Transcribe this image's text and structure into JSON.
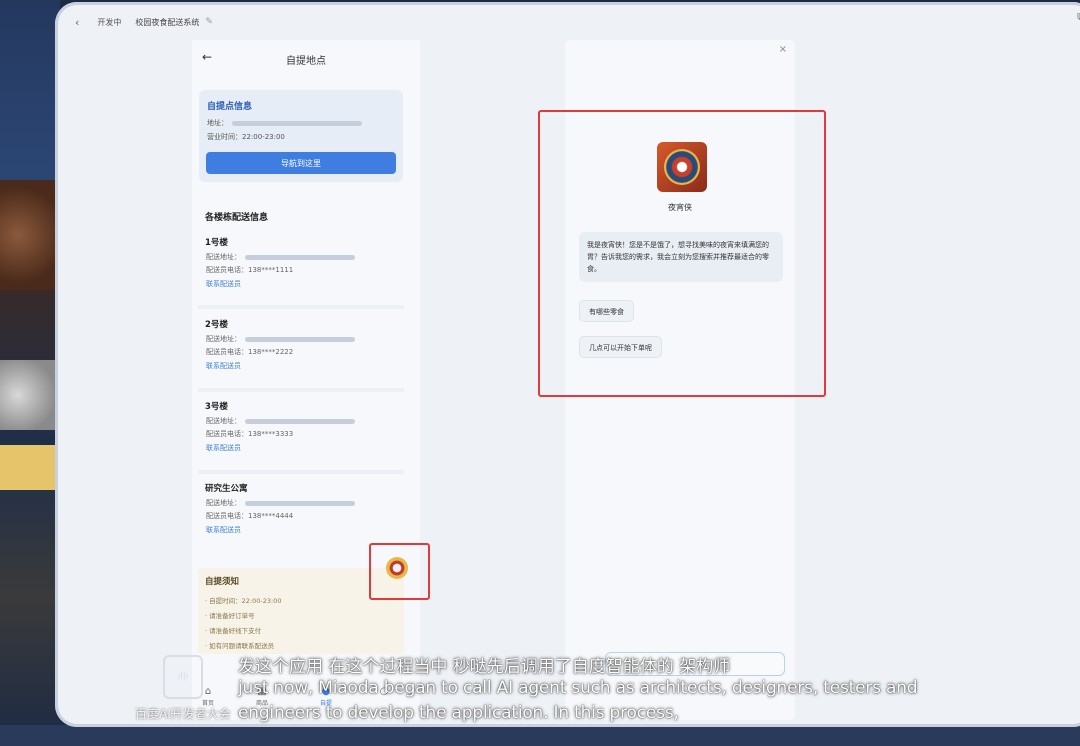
{
  "topbar": {
    "back_icon": "chevron-left-icon",
    "status": "开发中",
    "app_title": "校园夜食配送系统",
    "edit_icon": "edit-icon",
    "expand_icon": "expand-icon"
  },
  "phone": {
    "header_title": "自提地点",
    "pickup": {
      "title": "自提点信息",
      "address_label": "地址：",
      "hours_label": "营业时间：",
      "hours_value": "22:00-23:00",
      "nav_button": "导航到这里"
    },
    "buildings_title": "各楼栋配送信息",
    "buildings": [
      {
        "name": "1号楼",
        "address_label": "配送地址：",
        "phone_label": "配送员电话：",
        "phone": "138****1111",
        "link": "联系配送员"
      },
      {
        "name": "2号楼",
        "address_label": "配送地址：",
        "phone_label": "配送员电话：",
        "phone": "138****2222",
        "link": "联系配送员"
      },
      {
        "name": "3号楼",
        "address_label": "配送地址：",
        "phone_label": "配送员电话：",
        "phone": "138****3333",
        "link": "联系配送员"
      },
      {
        "name": "研究生公寓",
        "address_label": "配送地址：",
        "phone_label": "配送员电话：",
        "phone": "138****4444",
        "link": "联系配送员"
      }
    ],
    "notice": {
      "title": "自提须知",
      "items": [
        "自提时间：22:00-23:00",
        "请准备好订单号",
        "请准备好线下支付",
        "如有问题请联系配送员"
      ]
    },
    "bottom_nav": [
      {
        "label": "首页",
        "icon": "home-icon"
      },
      {
        "label": "商品",
        "icon": "goods-icon"
      },
      {
        "label": "自提",
        "icon": "location-icon"
      },
      {
        "label": "",
        "icon": "user-icon"
      }
    ]
  },
  "chat": {
    "close_icon": "close-icon",
    "agent_name": "夜宵侠",
    "greeting": "我是夜宵侠！您是不是饿了，想寻找美味的夜宵来填满您的胃？告诉我您的需求，我会立刻为您搜索并推荐最适合的零食。",
    "suggestions": [
      "有哪些零食",
      "几点可以开始下单呢"
    ]
  },
  "subtitles": {
    "brand": "百度AI开发者大会",
    "logo_text": "ıl|ı",
    "cn": "发这个应用 在这个过程当中 秒哒先后调用了自度智能体的 架构师",
    "en_line1": "just now, Miaoda began to call AI agent such as architects, designers, testers and",
    "en_line2": "engineers to develop the application. In this process,"
  },
  "colors": {
    "accent": "#3f7ee0",
    "highlight": "#e03a3a",
    "pickup_title": "#2b5fb8"
  }
}
